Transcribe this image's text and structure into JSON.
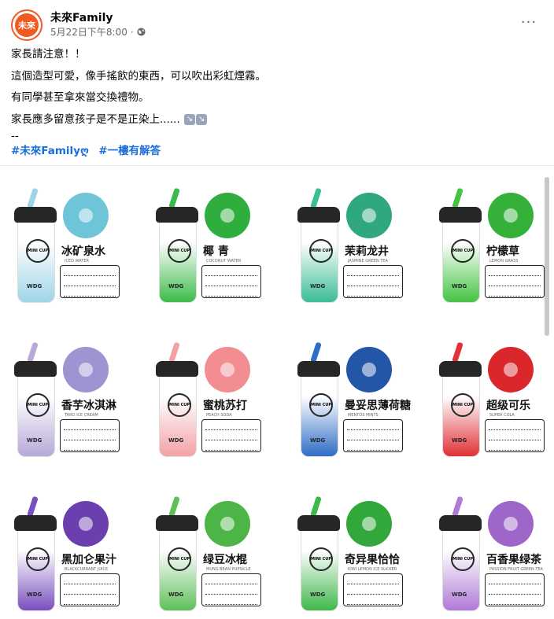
{
  "header": {
    "avatar_text": "未來",
    "page_name": "未來Family",
    "timestamp": "5月22日下午8:00",
    "separator": "·",
    "more_label": "···"
  },
  "post": {
    "lines": [
      "家長請注意！！",
      "這個造型可愛，像手搖飲的東西，可以吹出彩虹煙霧。",
      "有同學甚至拿來當交換禮物。",
      "家長應多留意孩子是不是正染上......"
    ],
    "dash": "--",
    "hashtags": [
      "#未來Familyღ",
      "#一樓有解答"
    ]
  },
  "image": {
    "cups": [
      {
        "name": "冰矿泉水",
        "sub": "ICED WATER",
        "cup_color": "#9fd4e8",
        "straw": "#9fd4e8",
        "circle": "#6ec5d8"
      },
      {
        "name": "椰 青",
        "sub": "COCONUT WATER",
        "cup_color": "#3dbb4a",
        "straw": "#3dbb4a",
        "circle": "#2fae3e"
      },
      {
        "name": "茉莉龙井",
        "sub": "JASMINE GREEN TEA",
        "cup_color": "#3bbd96",
        "straw": "#3bbd96",
        "circle": "#2fa882"
      },
      {
        "name": "柠檬草",
        "sub": "LEMON GRASS",
        "cup_color": "#44c442",
        "straw": "#44c442",
        "circle": "#35b13a"
      },
      {
        "name": "香芋冰淇淋",
        "sub": "TARO ICE CREAM",
        "cup_color": "#b8a9d9",
        "straw": "#b8a9d9",
        "circle": "#a093d1"
      },
      {
        "name": "蜜桃苏打",
        "sub": "PEACH SODA",
        "cup_color": "#f2a2a6",
        "straw": "#f2a2a6",
        "circle": "#f28d92"
      },
      {
        "name": "曼妥思薄荷糖",
        "sub": "MENTOS MINTS",
        "cup_color": "#2f6dc6",
        "straw": "#2f6dc6",
        "circle": "#2456a8"
      },
      {
        "name": "超级可乐",
        "sub": "SUPER COLA",
        "cup_color": "#e03136",
        "straw": "#e03136",
        "circle": "#d9272c"
      },
      {
        "name": "黑加仑果汁",
        "sub": "BLACKCURRANT JUICE",
        "cup_color": "#7a4fbf",
        "straw": "#7a4fbf",
        "circle": "#6b3fae"
      },
      {
        "name": "绿豆冰棍",
        "sub": "MUNG BEAN POPSICLE",
        "cup_color": "#5fc05a",
        "straw": "#5fc05a",
        "circle": "#4db548"
      },
      {
        "name": "奇异果恰恰",
        "sub": "KIWI LEMON ICE SUCKER",
        "cup_color": "#3fb84a",
        "straw": "#3fb84a",
        "circle": "#31a73c"
      },
      {
        "name": "百香果绿茶",
        "sub": "PASSION FRUIT GREEN TEA",
        "cup_color": "#b07ad8",
        "straw": "#b07ad8",
        "circle": "#9f66c9"
      }
    ],
    "cup_logo": "MINI CUP",
    "cup_brand": "WDG"
  }
}
